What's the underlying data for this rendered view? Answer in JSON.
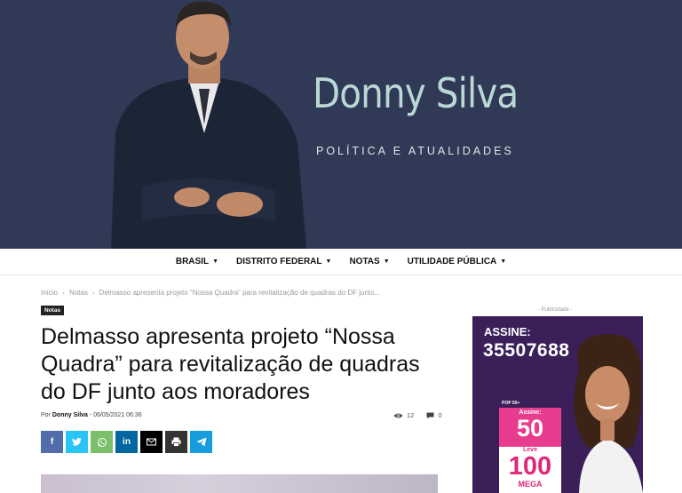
{
  "header": {
    "brand_name": "Donny Silva",
    "tagline": "POLÍTICA E ATUALIDADES"
  },
  "nav": {
    "items": [
      {
        "label": "BRASIL"
      },
      {
        "label": "DISTRITO FEDERAL"
      },
      {
        "label": "NOTAS"
      },
      {
        "label": "UTILIDADE PÚBLICA"
      }
    ]
  },
  "breadcrumb": {
    "home": "Início",
    "section": "Notas",
    "current": "Delmasso apresenta projeto “Nossa Quadra” para revitalização de quadras do DF junto..."
  },
  "article": {
    "category": "Notas",
    "title": "Delmasso apresenta projeto “Nossa Quadra” para revitalização de quadras do DF junto aos moradores",
    "by_label": "Por",
    "author": "Donny Silva",
    "date_separator": "-",
    "date": "06/05/2021 06:36",
    "views": "12",
    "comments": "0"
  },
  "share": {
    "buttons": [
      {
        "name": "facebook",
        "glyph": "f",
        "color": "#516eab"
      },
      {
        "name": "twitter",
        "glyph": "🐦",
        "color": "#29c5f6"
      },
      {
        "name": "whatsapp",
        "glyph": "✆",
        "color": "#7bbf6a"
      },
      {
        "name": "linkedin",
        "glyph": "in",
        "color": "#0266a0"
      },
      {
        "name": "email",
        "glyph": "✉",
        "color": "#000000"
      },
      {
        "name": "print",
        "glyph": "⎙",
        "color": "#333333"
      },
      {
        "name": "telegram",
        "glyph": "➤",
        "color": "#179cde"
      }
    ]
  },
  "sidebar": {
    "ad_label": "- Publicidade -",
    "ad": {
      "assine": "ASSINE:",
      "phone": "35507688",
      "pop": "POP 50+",
      "box1_line": "Assine:",
      "box1_big": "50",
      "box2_line": "Leve",
      "box2_big": "100",
      "box2_unit": "MEGA"
    }
  },
  "colors": {
    "banner_bg": "#303955",
    "brand_text": "#b9d8d6",
    "ad_bg": "#3a1f59",
    "ad_pink": "#e83d8f"
  }
}
